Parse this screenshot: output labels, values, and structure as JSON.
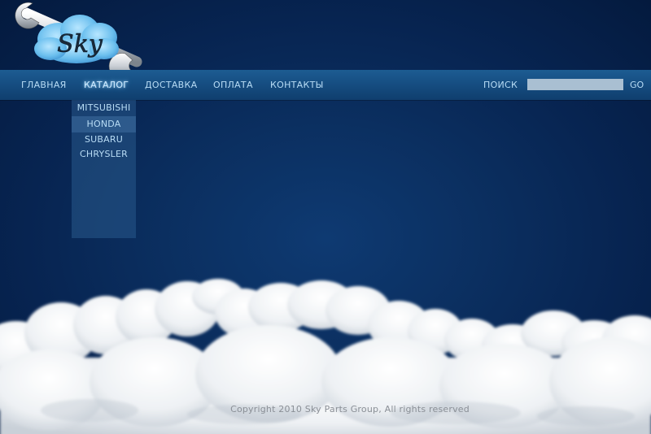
{
  "logo": {
    "text": "Sky",
    "accent_color": "#5cb3e8"
  },
  "nav": {
    "items": [
      {
        "label": "ГЛАВНАЯ"
      },
      {
        "label": "КАТАЛОГ"
      },
      {
        "label": "ДОСТАВКА"
      },
      {
        "label": "ОПЛАТА"
      },
      {
        "label": "КОНТАКТЫ"
      }
    ],
    "active": "КАТАЛОГ",
    "text_color": "#b8dcf5"
  },
  "search": {
    "label": "ПОИСК",
    "value": "",
    "go_label": "GO"
  },
  "dropdown": {
    "items": [
      {
        "label": "MITSUBISHI"
      },
      {
        "label": "HONDA"
      },
      {
        "label": "SUBARU"
      },
      {
        "label": "CHRYSLER"
      }
    ],
    "highlighted": "HONDA"
  },
  "footer": {
    "copyright": "Copyright 2010 Sky Parts Group, All rights reserved"
  },
  "colors": {
    "sky": "#0b2f60",
    "navbar": "#164e82",
    "cloud": "#ffffff"
  }
}
